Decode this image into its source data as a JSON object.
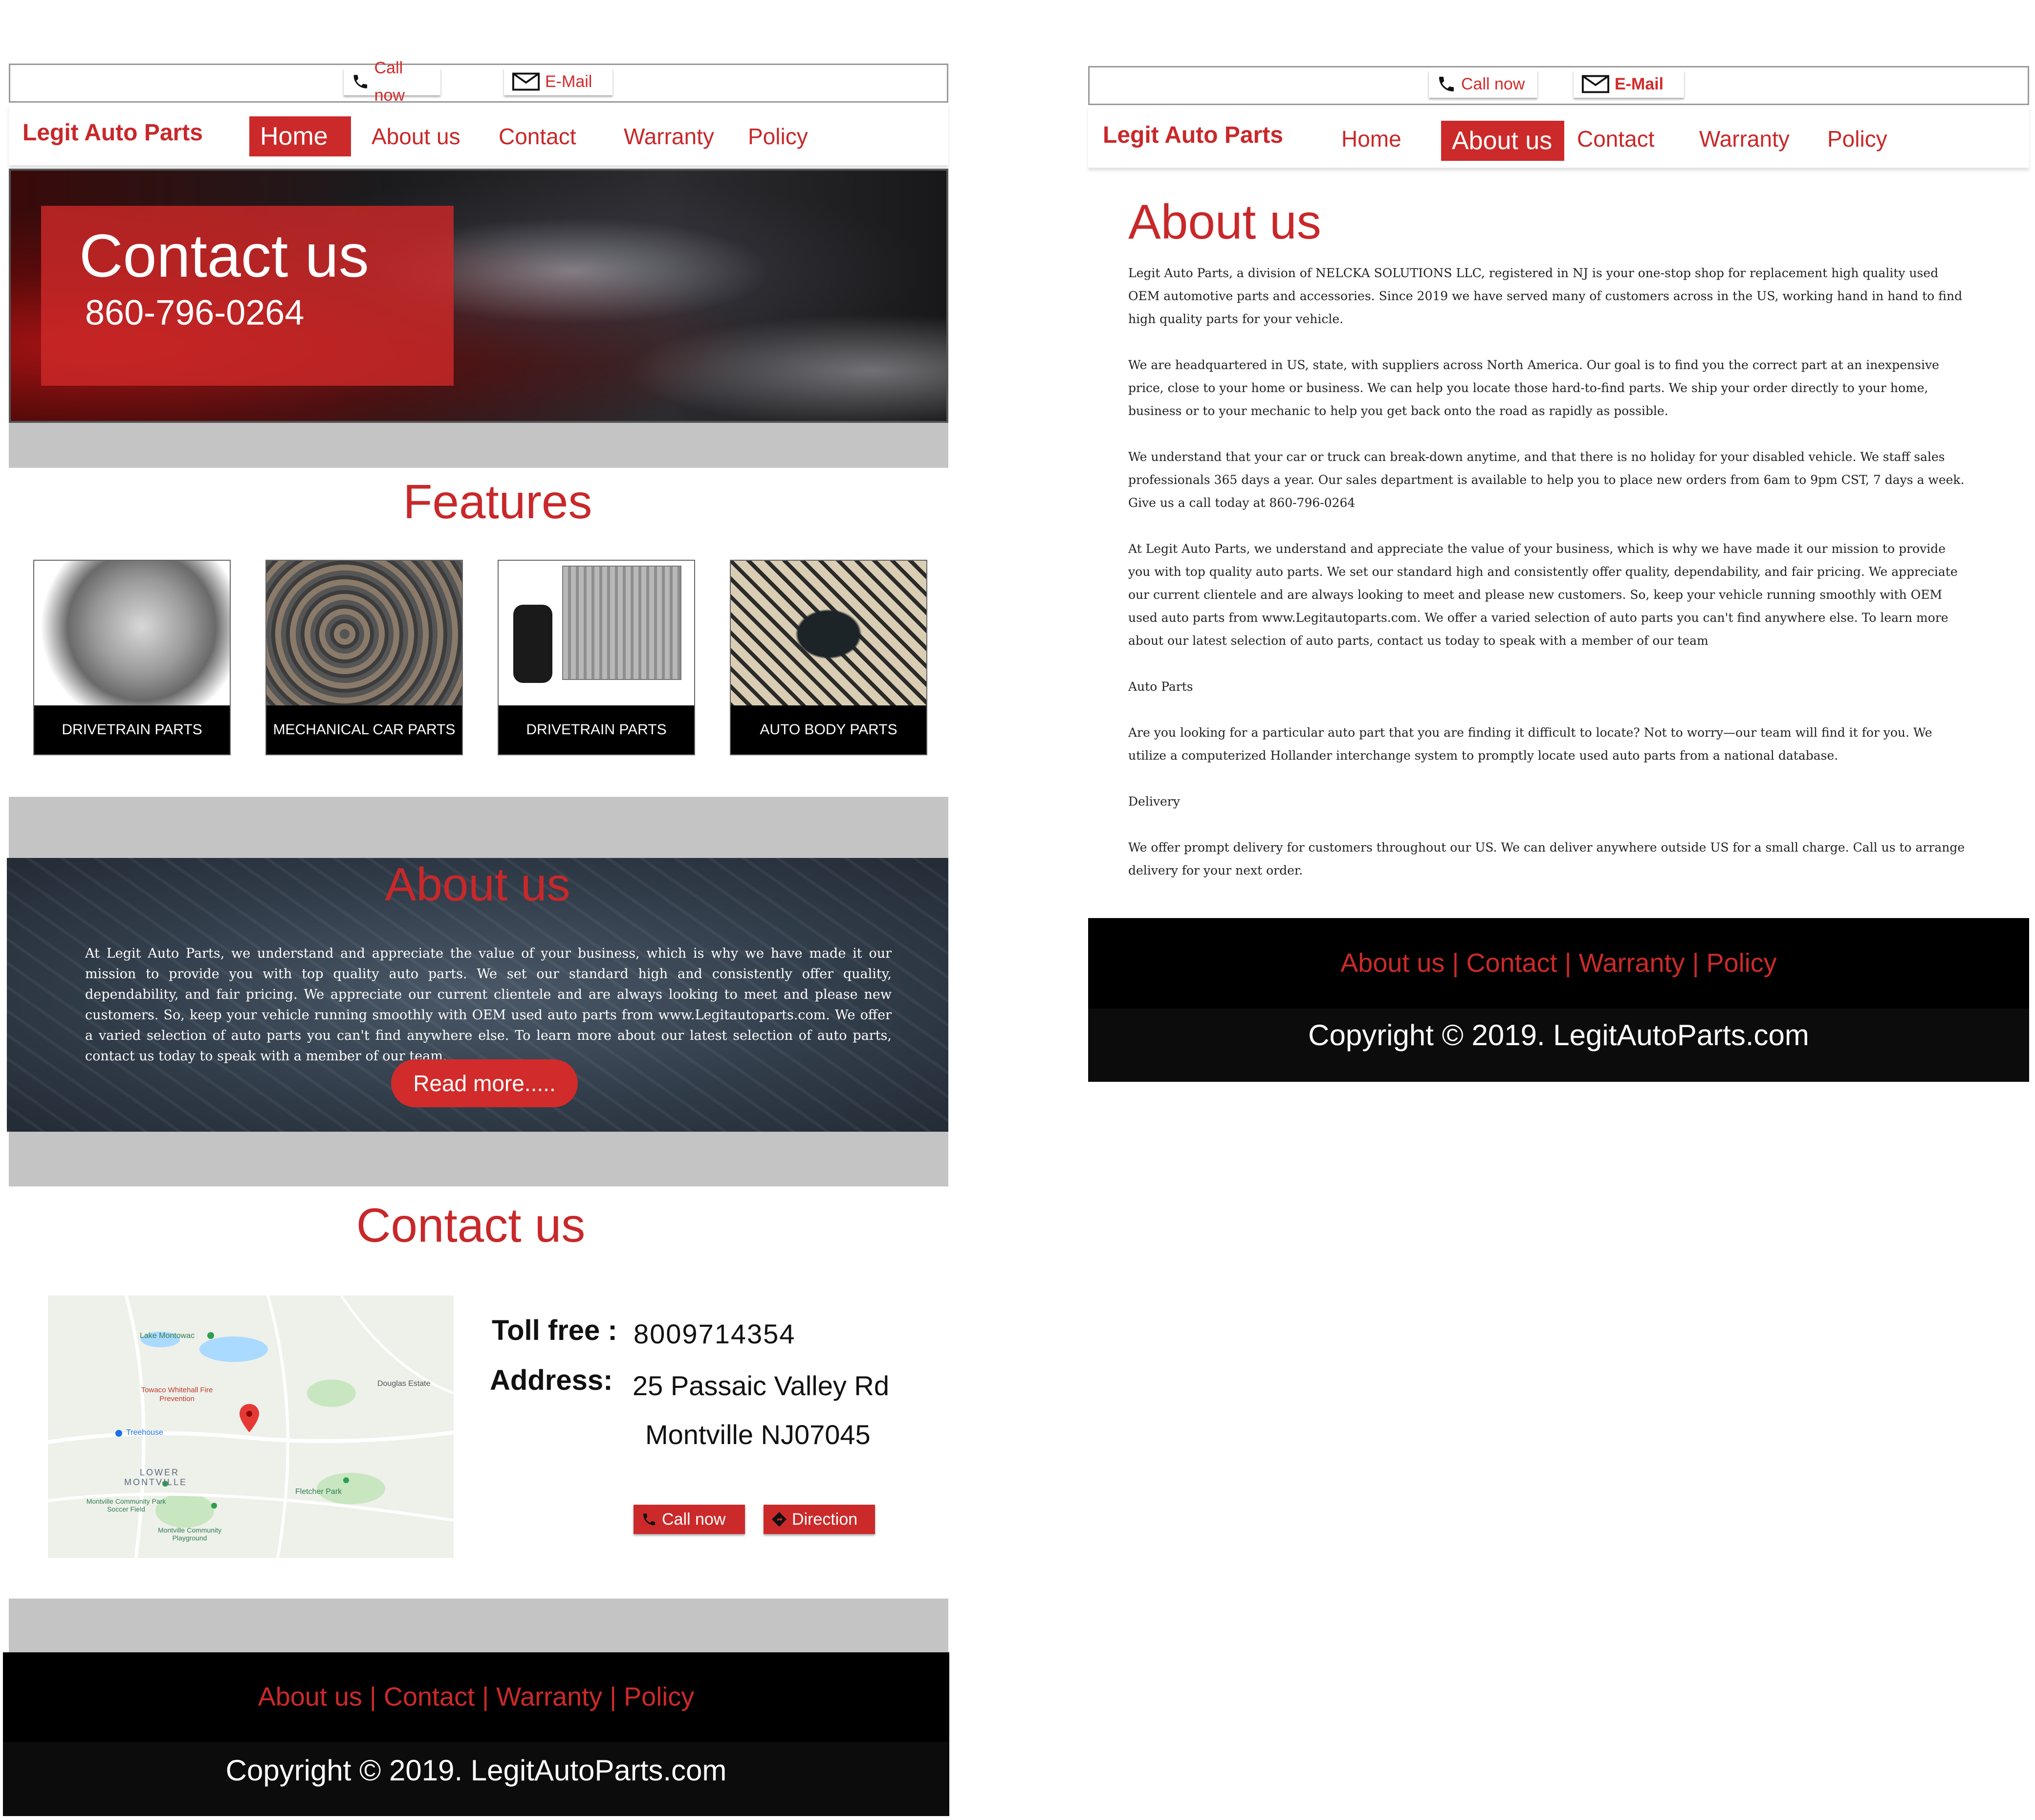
{
  "colors": {
    "brand_red": "#cc2a2a",
    "grey_band": "#c4c4c4",
    "footer_black": "#000000"
  },
  "topbar": {
    "call_label": "Call now",
    "email_label": "E-Mail"
  },
  "brand": "Legit Auto Parts",
  "nav": {
    "home": "Home",
    "about": "About us",
    "contact": "Contact",
    "warranty": "Warranty",
    "policy": "Policy"
  },
  "home_page": {
    "hero": {
      "title": "Contact us",
      "phone": "860-796-0264"
    },
    "features": {
      "title": "Features",
      "items": [
        {
          "label": "DRIVETRAIN PARTS",
          "icon": "gearbox-image"
        },
        {
          "label": "MECHANICAL CAR PARTS",
          "icon": "gears-image"
        },
        {
          "label": "DRIVETRAIN PARTS",
          "icon": "ecu-module-image"
        },
        {
          "label": "AUTO BODY PARTS",
          "icon": "car-parts-image"
        }
      ]
    },
    "about": {
      "title": "About us",
      "text": "At Legit Auto Parts, we understand and appreciate the value of your business, which is why we have made it our mission to provide you with top quality auto parts. We set our standard high and consistently offer quality, dependability, and fair pricing. We appreciate our current clientele and are always looking to meet and please new customers. So, keep your vehicle running smoothly with OEM used auto parts from www.Legitautoparts.com. We offer a varied selection of auto parts you can't find anywhere else. To learn more about our latest selection of auto parts, contact us today to speak with a member of our team.",
      "button": "Read more....."
    },
    "contact": {
      "title": "Contact us",
      "toll_free_label": "Toll free :",
      "toll_free_value": "8009714354",
      "address_label": "Address:",
      "address_line1": "25 Passaic Valley Rd",
      "address_line2": "Montville NJ07045",
      "call_button": "Call now",
      "direction_button": "Direction",
      "map_labels": {
        "lake": "Lake Montowac",
        "fire": "Towaco Whitehall Fire Prevention",
        "douglas": "Douglas Estate",
        "treehouse": "Treehouse",
        "lower_montville_1": "LOWER",
        "lower_montville_2": "MONTVILLE",
        "fletcher": "Fletcher Park",
        "soccer": "Montville Community Park Soccer Field",
        "playground": "Montville Community Playground"
      }
    }
  },
  "about_page": {
    "title": "About us",
    "paragraphs": [
      "Legit Auto Parts, a division of NELCKA SOLUTIONS LLC, registered in NJ is your one-stop shop for replacement high quality used OEM automotive parts and accessories. Since 2019 we have served many of customers across in the US, working hand in hand to find high quality parts for your vehicle.",
      "We are headquartered in US, state, with suppliers across North America. Our goal is to find you the correct part at an inexpensive price, close to your home or business. We can help you locate those hard-to-find parts. We ship your order directly to your home, business or to your mechanic to help you get back onto the road as rapidly as possible.",
      "We understand that your car or truck can break-down anytime, and that there is no holiday for your disabled vehicle. We staff sales professionals 365 days a year. Our sales department is available to help you to place new orders from 6am to 9pm CST, 7 days a week. Give us a call today at 860-796-0264",
      "At Legit Auto Parts, we understand and appreciate the value of your business, which is why we have made it our mission to provide you with top quality auto parts. We set our standard high and consistently offer quality, dependability, and fair pricing. We appreciate our current clientele and are always looking to meet and please new customers. So, keep your vehicle running smoothly with OEM used auto parts from www.Legitautoparts.com. We offer a varied selection of auto parts you can't find anywhere else. To learn more about our latest selection of auto parts, contact us today to speak with a member of our team",
      "Auto Parts",
      "Are you looking for a particular auto part that you are finding it difficult to locate? Not to worry—our team will find it for you. We utilize a computerized Hollander interchange system to promptly locate used auto parts from a national database.",
      "Delivery",
      "We offer prompt delivery for customers throughout our US. We can deliver anywhere outside US for a small charge. Call us to arrange delivery for your next order."
    ]
  },
  "footer": {
    "links": "About us | Contact | Warranty | Policy",
    "copyright": "Copyright © 2019. LegitAutoParts.com"
  }
}
